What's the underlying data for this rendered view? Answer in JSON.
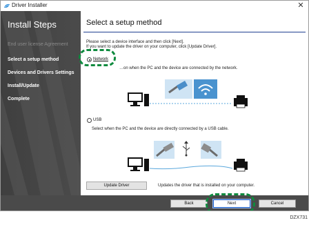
{
  "window": {
    "title": "Driver Installer",
    "close_glyph": "✕"
  },
  "sidebar": {
    "title": "Install Steps",
    "steps": [
      {
        "label": "End user license Agreement",
        "state": "done"
      },
      {
        "label": "Select a setup method",
        "state": "current"
      },
      {
        "label": "Devices and Drivers Settings",
        "state": "pending"
      },
      {
        "label": "Install/Update",
        "state": "pending"
      },
      {
        "label": "Complete",
        "state": "pending"
      }
    ]
  },
  "main": {
    "title": "Select a setup method",
    "instruction_1": "Please select a device interface and then click [Next].",
    "instruction_2": "If you want to update the driver on your computer, click [Update Driver].",
    "options": [
      {
        "label": "Network",
        "selected": true,
        "description": "…on when the PC and the device are connected by the network."
      },
      {
        "label": "USB",
        "selected": false,
        "description": "Select when the PC and the device are directly connected by a USB cable."
      }
    ],
    "update_button": "Update Driver",
    "update_description": "Updates the driver that is installed on your computer."
  },
  "footer": {
    "back_label": "Back",
    "next_label": "Next",
    "cancel_label": "Cancel"
  },
  "figure_code": "DZX731",
  "colors": {
    "sidebar_bg": "#474747",
    "accent_rule": "#1f3f8f",
    "callout_green": "#0e8a3e",
    "illustration_blue": "#5aa7dc"
  }
}
